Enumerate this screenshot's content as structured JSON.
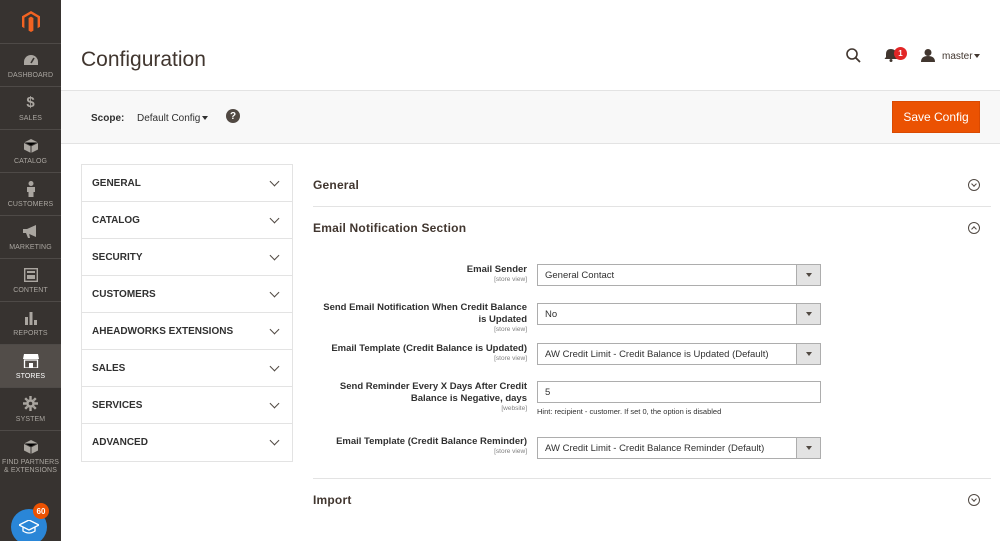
{
  "nav": {
    "items": [
      {
        "label": "Dashboard",
        "icon": "dashboard-icon"
      },
      {
        "label": "Sales",
        "icon": "dollar-icon"
      },
      {
        "label": "Catalog",
        "icon": "cube-icon"
      },
      {
        "label": "Customers",
        "icon": "person-icon"
      },
      {
        "label": "Marketing",
        "icon": "megaphone-icon"
      },
      {
        "label": "Content",
        "icon": "layout-icon"
      },
      {
        "label": "Reports",
        "icon": "bar-chart-icon"
      },
      {
        "label": "Stores",
        "icon": "store-icon"
      },
      {
        "label": "System",
        "icon": "gear-icon"
      },
      {
        "label": "Find Partners & Extensions",
        "icon": "box-icon"
      }
    ],
    "notification_count": "60"
  },
  "header": {
    "title": "Configuration",
    "notifications": "1",
    "user": "master"
  },
  "scope": {
    "label": "Scope:",
    "value": "Default Config",
    "save_label": "Save Config"
  },
  "tabs": [
    {
      "label": "GENERAL"
    },
    {
      "label": "CATALOG"
    },
    {
      "label": "SECURITY"
    },
    {
      "label": "CUSTOMERS"
    },
    {
      "label": "AHEADWORKS EXTENSIONS"
    },
    {
      "label": "SALES"
    },
    {
      "label": "SERVICES"
    },
    {
      "label": "ADVANCED"
    }
  ],
  "sections": {
    "general": "General",
    "email": "Email Notification Section",
    "import": "Import"
  },
  "form": {
    "email_sender": {
      "label": "Email Sender",
      "scope": "[store view]",
      "value": "General Contact"
    },
    "send_notification": {
      "label": "Send Email Notification When Credit Balance is Updated",
      "scope": "[store view]",
      "value": "No"
    },
    "template_updated": {
      "label": "Email Template (Credit Balance is Updated)",
      "scope": "[store view]",
      "value": "AW Credit Limit - Credit Balance is Updated (Default)"
    },
    "reminder_days": {
      "label": "Send Reminder Every X Days After Credit Balance is Negative, days",
      "scope": "[website]",
      "value": "5",
      "hint": "Hint: recipient - customer. If set 0, the option is disabled"
    },
    "template_reminder": {
      "label": "Email Template (Credit Balance Reminder)",
      "scope": "[store view]",
      "value": "AW Credit Limit - Credit Balance Reminder (Default)"
    }
  },
  "colors": {
    "accent": "#eb5202",
    "sidebar": "#373330",
    "link": "#2a86d7"
  }
}
